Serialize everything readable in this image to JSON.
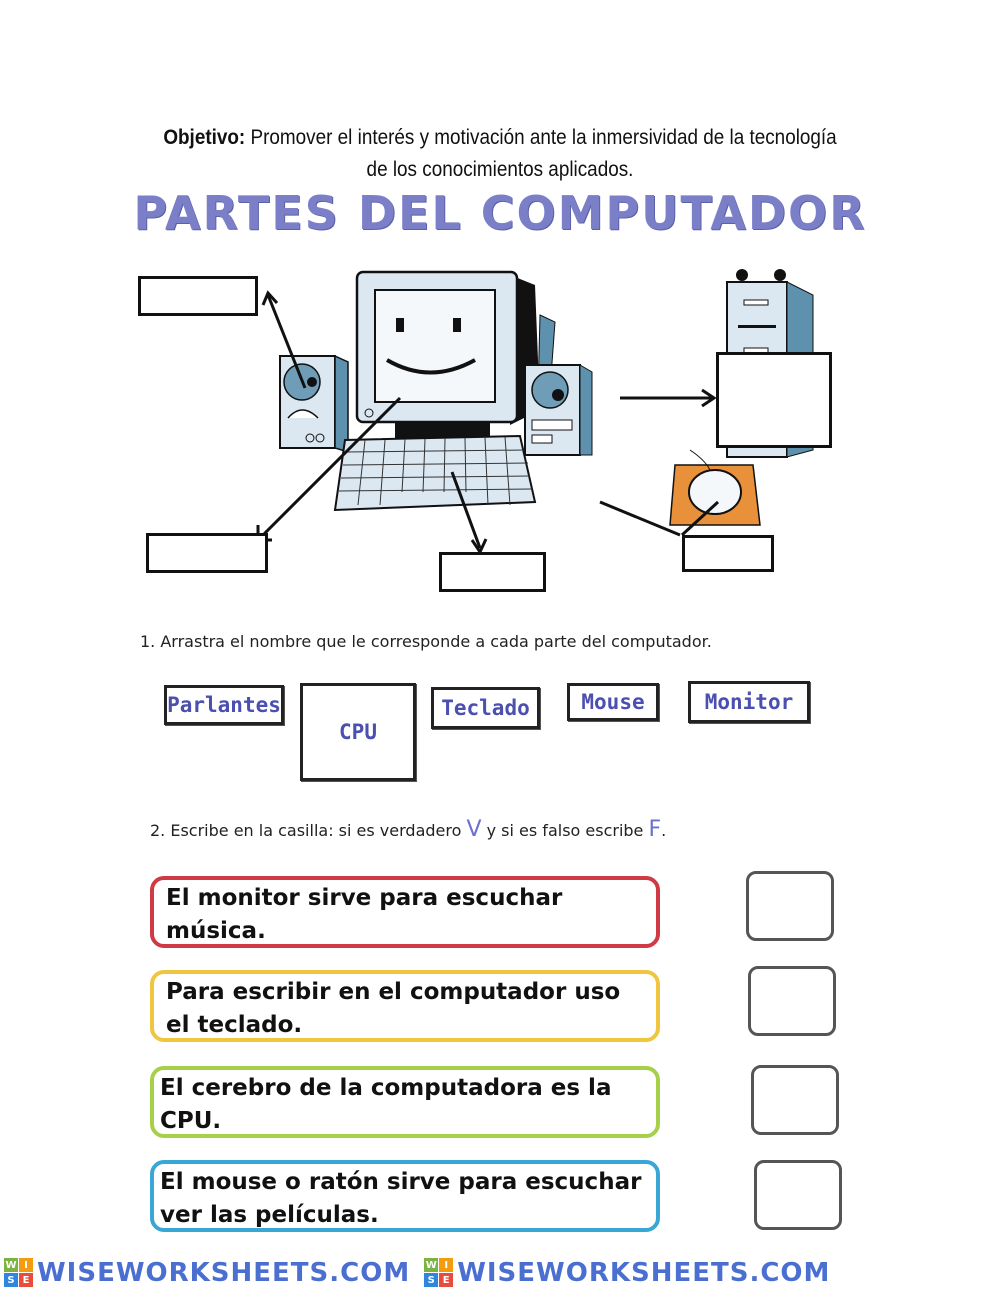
{
  "header": {
    "objective_label": "Objetivo:",
    "objective_text": "Promover el interés y motivación ante la inmersividad de la tecnología de los conocimientos aplicados.",
    "title": "PARTES DEL COMPUTADOR"
  },
  "illustration": {
    "description": "Computer with monitor, speakers, CPU tower, keyboard and mouse with arrows to blank label boxes",
    "drop_targets": [
      "speaker-label",
      "cpu-label",
      "monitor-label",
      "keyboard-label",
      "mouse-label"
    ]
  },
  "section1": {
    "instruction": "1. Arrastra el nombre que le corresponde a cada parte del computador.",
    "chips": [
      "Parlantes",
      "CPU",
      "Teclado",
      "Mouse",
      "Monitor"
    ]
  },
  "section2": {
    "instruction_a": "2. Escribe en la casilla: si es verdadero ",
    "v": "V",
    "instruction_b": " y si es falso escribe ",
    "f": "F",
    "instruction_c": ".",
    "statements": [
      {
        "text": "El monitor sirve para escuchar música.",
        "color": "#d03a45"
      },
      {
        "text": "Para escribir en el computador uso el teclado.",
        "color": "#f0c640"
      },
      {
        "text": "El cerebro de la computadora es la CPU.",
        "color": "#a7d04a"
      },
      {
        "text": "El mouse o ratón sirve para escuchar ver las películas.",
        "color": "#3aa6d6"
      }
    ],
    "answers": [
      "",
      "",
      "",
      ""
    ]
  },
  "footer": {
    "logo_letters": [
      "W",
      "I",
      "S",
      "E"
    ],
    "brand": "WISEWORKSHEETS.COM"
  }
}
